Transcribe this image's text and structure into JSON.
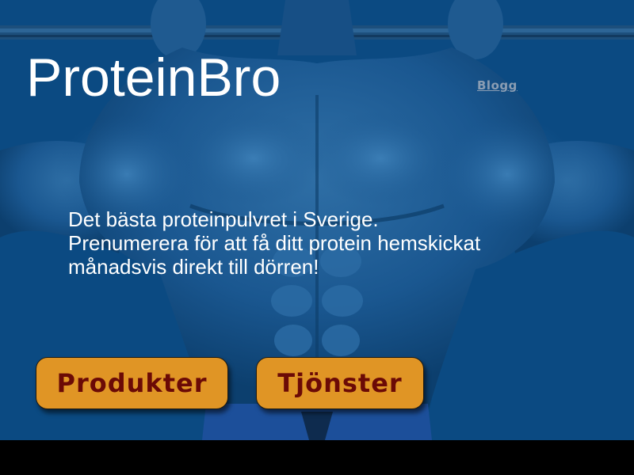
{
  "site": {
    "title": "ProteinBro"
  },
  "nav": {
    "blog_label": "Blogg"
  },
  "hero": {
    "tagline_lines": [
      "Det bästa proteinpulvret i Sverige.",
      "Prenumerera för att få ditt protein hemskickat",
      "månadsvis direkt till dörren!"
    ],
    "background_color": "#0b4a82"
  },
  "buttons": {
    "products_label": "Produkter",
    "services_label": "Tjönster",
    "color": "#e09525",
    "text_color": "#6b0a06"
  }
}
